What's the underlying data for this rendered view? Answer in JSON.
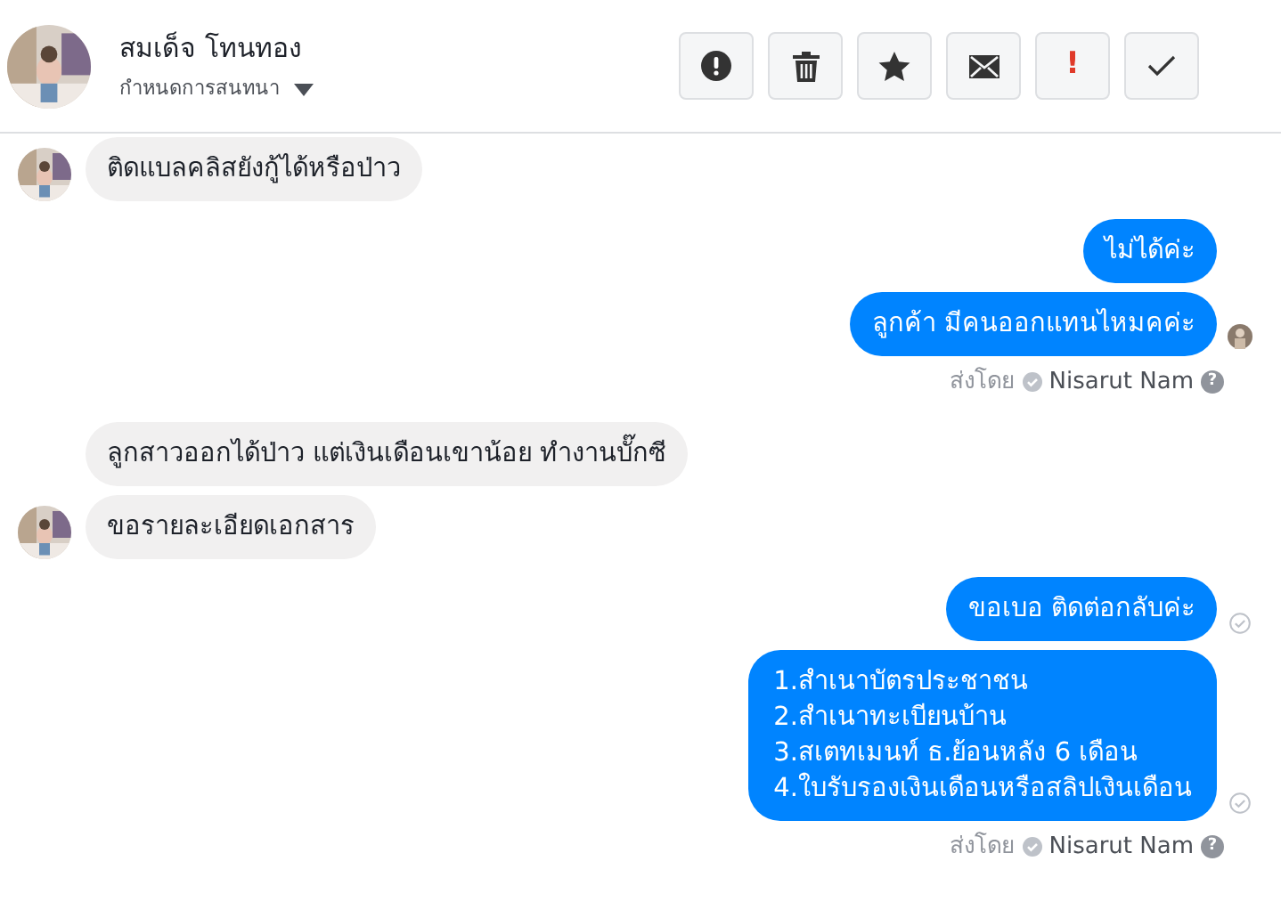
{
  "header": {
    "contact_name": "สมเด็จ โทนทอง",
    "subtitle": "กำหนดการสนทนา",
    "actions": [
      {
        "kind": "alert"
      },
      {
        "kind": "trash"
      },
      {
        "kind": "star"
      },
      {
        "kind": "mail"
      },
      {
        "kind": "text",
        "label": "!"
      },
      {
        "kind": "check"
      }
    ]
  },
  "messages": [
    {
      "kind": "incoming",
      "text": "ติดแบลคลิสยังกู้ได้หรือป่าว",
      "avatar": true
    },
    {
      "kind": "outgoing",
      "text": "ไม่ได้ค่ะ",
      "seen": false,
      "delivered": false
    },
    {
      "kind": "outgoing",
      "text": "ลูกค้า มีคนออกแทนไหมคค่ะ",
      "seen": true,
      "delivered": false
    },
    {
      "kind": "sender",
      "prefix": "ส่งโดย",
      "name": "Nisarut Nam",
      "help": "?"
    },
    {
      "kind": "incoming",
      "text": "ลูกสาวออกได้ป่าว แต่เงินเดือนเขาน้อย ทำงานบั๊กซี",
      "avatar": false
    },
    {
      "kind": "incoming",
      "text": "ขอรายละเอียดเอกสาร",
      "avatar": true
    },
    {
      "kind": "outgoing",
      "text": "ขอเบอ ติดต่อกลับค่ะ",
      "seen": false,
      "delivered": true
    },
    {
      "kind": "outgoing",
      "lines": [
        "1.สำเนาบัตรประชาชน",
        "2.สำเนาทะเบียนบ้าน",
        "3.สเตทเมนท์ ธ.ย้อนหลัง 6 เดือน",
        "4.ใบรับรองเงินเดือนหรือสลิปเงินเดือน"
      ],
      "seen": false,
      "delivered": true
    },
    {
      "kind": "sender",
      "prefix": "ส่งโดย",
      "name": "Nisarut Nam",
      "help": "?"
    }
  ]
}
